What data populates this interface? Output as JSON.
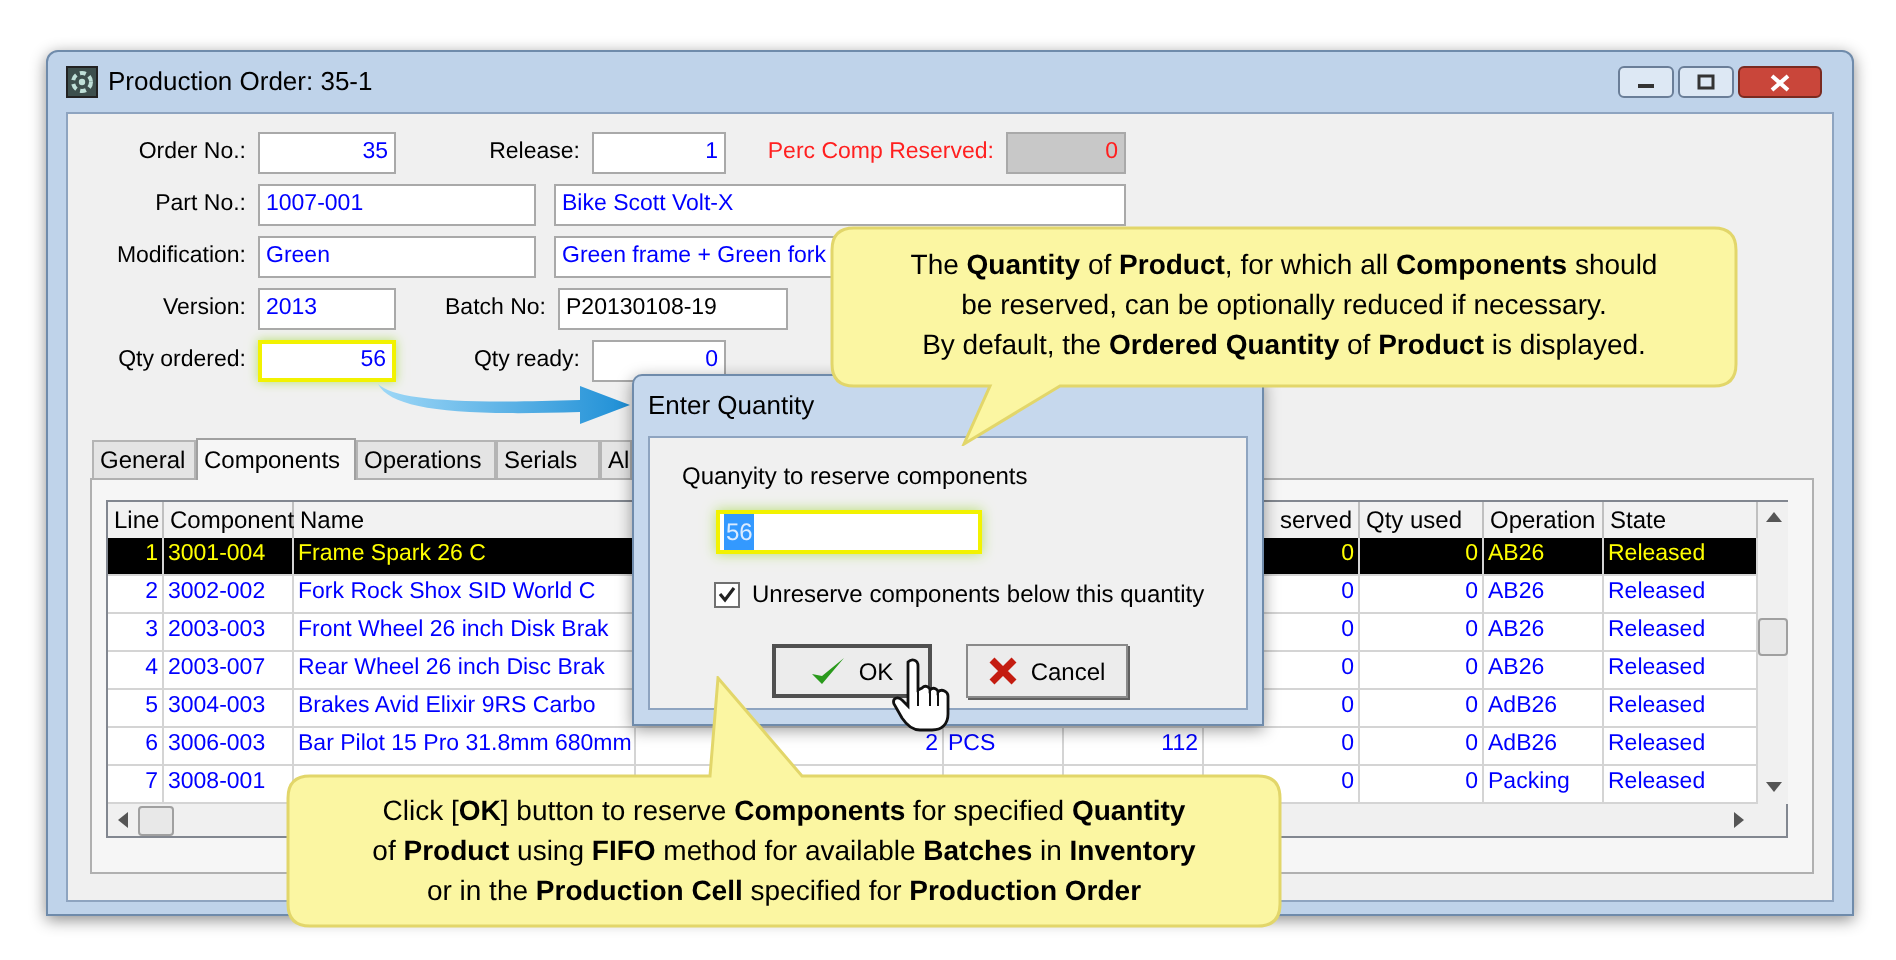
{
  "window": {
    "title": "Production Order: 35-1"
  },
  "form": {
    "order_no": {
      "label": "Order No.:",
      "value": "35"
    },
    "release": {
      "label": "Release:",
      "value": "1"
    },
    "perc_comp_reserved": {
      "label": "Perc Comp Reserved:",
      "value": "0"
    },
    "part_no": {
      "label": "Part No.:",
      "value": "1007-001",
      "description": "Bike Scott Volt-X"
    },
    "modification": {
      "label": "Modification:",
      "value": "Green",
      "description": "Green frame + Green fork"
    },
    "version": {
      "label": "Version:",
      "value": "2013"
    },
    "batch_no": {
      "label": "Batch No:",
      "value": "P20130108-19"
    },
    "qty_ordered": {
      "label": "Qty ordered:",
      "value": "56",
      "highlighted": true
    },
    "qty_ready": {
      "label": "Qty ready:",
      "value": "0"
    }
  },
  "tabs": [
    {
      "label": "General",
      "selected": false
    },
    {
      "label": "Components",
      "selected": true
    },
    {
      "label": "Operations",
      "selected": false
    },
    {
      "label": "Serials",
      "selected": false
    },
    {
      "label": "Al",
      "selected": false
    }
  ],
  "table": {
    "columns": [
      "Line",
      "Component",
      "Name",
      "served",
      "Qty used",
      "Operation",
      "State"
    ],
    "rows": [
      {
        "line": "1",
        "component": "3001-004",
        "name": "Frame Spark 26 C",
        "reserved": "0",
        "qty_used": "0",
        "operation": "AB26",
        "state": "Released",
        "selected": true
      },
      {
        "line": "2",
        "component": "3002-002",
        "name": "Fork Rock Shox SID World C",
        "reserved": "0",
        "qty_used": "0",
        "operation": "AB26",
        "state": "Released",
        "selected": false
      },
      {
        "line": "3",
        "component": "2003-003",
        "name": "Front Wheel 26 inch Disk Brak",
        "reserved": "0",
        "qty_used": "0",
        "operation": "AB26",
        "state": "Released",
        "selected": false
      },
      {
        "line": "4",
        "component": "2003-007",
        "name": "Rear Wheel 26 inch Disc Brak",
        "reserved": "0",
        "qty_used": "0",
        "operation": "AB26",
        "state": "Released",
        "selected": false
      },
      {
        "line": "5",
        "component": "3004-003",
        "name": "Brakes Avid Elixir 9RS Carbo",
        "reserved": "0",
        "qty_used": "0",
        "operation": "AdB26",
        "state": "Released",
        "selected": false
      },
      {
        "line": "6",
        "component": "3006-003",
        "name": "Bar Pilot 15 Pro 31.8mm 680mm",
        "column_4": "2",
        "column_5": "PCS",
        "column_6": "112",
        "reserved": "0",
        "qty_used": "0",
        "operation": "AdB26",
        "state": "Released",
        "selected": false
      },
      {
        "line": "7",
        "component": "3008-001",
        "reserved": "0",
        "qty_used": "0",
        "operation": "Packing",
        "state": "Released",
        "selected": false
      }
    ]
  },
  "dialog": {
    "title": "Enter Quantity",
    "prompt": "Quanyity to reserve components",
    "value": "56",
    "checkbox": {
      "label": "Unreserve components below this quantity",
      "checked": true
    },
    "buttons": [
      {
        "label": "OK",
        "kind": "ok"
      },
      {
        "label": "Cancel",
        "kind": "cancel"
      }
    ]
  },
  "callouts": [
    {
      "text": "The **Quantity** of **Product**, for which all **Components** should\nbe reserved, can be optionally reduced if necessary.\nBy default, the **Ordered Quantity** of **Product** is displayed."
    },
    {
      "text": "Click [**OK**] button to reserve **Components** for specified **Quantity**\nof **Product** using **FIFO** method for available **Batches** in **Inventory**\nor in the **Production Cell** specified for **Production Order**"
    }
  ]
}
